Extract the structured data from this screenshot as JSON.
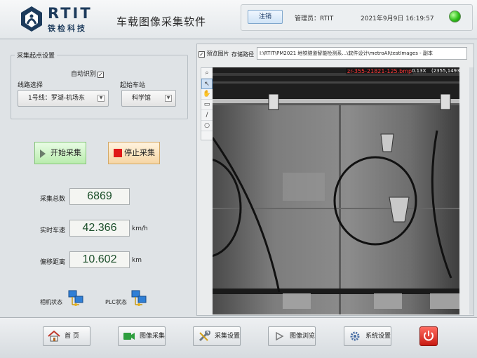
{
  "header": {
    "logo_text": "RTIT",
    "logo_sub": "铁检科技",
    "app_title": "车载图像采集软件",
    "logout_label": "注销",
    "admin_label": "管理员：RTIT",
    "datetime": "2021年9月9日  16:19:57",
    "status_color": "#2fbf1a"
  },
  "acquisition_settings": {
    "group_title": "采集起点设置",
    "auto_identify_label": "自动识别",
    "auto_identify_checked": true,
    "line_label": "线路选择",
    "line_value": "1号线：罗湖-机场东",
    "station_label": "起始车站",
    "station_value": "科学馆"
  },
  "controls": {
    "start_label": "开始采集",
    "stop_label": "停止采集"
  },
  "metrics": {
    "total_label": "采集总数",
    "total_value": "6869",
    "speed_label": "实时车速",
    "speed_value": "42.366",
    "speed_unit": "km/h",
    "offset_label": "偏移距离",
    "offset_value": "10.602",
    "offset_unit": "km"
  },
  "status": {
    "camera_label": "相机状态",
    "plc_label": "PLC状态"
  },
  "image_panel": {
    "preview_label": "预览图片",
    "preview_checked": true,
    "save_path_label": "存储路径",
    "save_path_value": "I:\\RTIT\\PM2021 地铁隧道智能检测系...\\软件设计\\metroAI\\testImages - 副本",
    "overlay_filename": "zr-355-21821-125.bmp",
    "overlay_zoom": "0.13X",
    "overlay_coord": "(2355,1493)",
    "tools": [
      "zoom-icon",
      "pointer-icon",
      "hand-icon",
      "rectangle-icon",
      "line-icon",
      "lasso-icon"
    ]
  },
  "nav": {
    "home_label": "首    页",
    "capture_label": "图像采集",
    "settings_label": "采集设置",
    "browse_label": "图像浏览",
    "system_label": "系统设置"
  },
  "colors": {
    "brand": "#1d3b5c",
    "metric_text": "#1c4f2a",
    "power": "#c81a12"
  }
}
